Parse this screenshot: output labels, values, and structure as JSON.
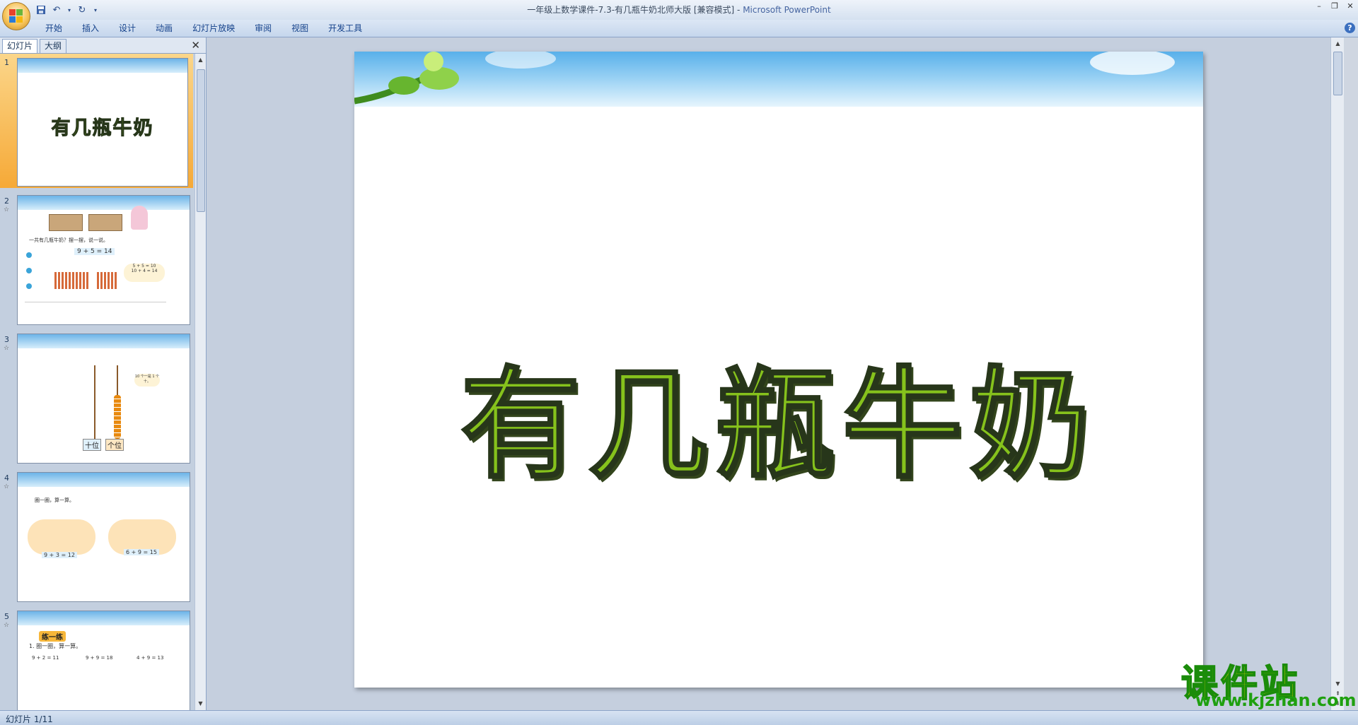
{
  "window": {
    "title": "一年级上数学课件-7.3-有几瓶牛奶北师大版 [兼容模式]",
    "separator": " - ",
    "app_name": "Microsoft PowerPoint"
  },
  "ribbon_tabs": [
    "开始",
    "插入",
    "设计",
    "动画",
    "幻灯片放映",
    "审阅",
    "视图",
    "开发工具"
  ],
  "pane": {
    "tab_slides": "幻灯片",
    "tab_outline": "大纲",
    "close": "✕"
  },
  "thumbnails": [
    {
      "num": "1",
      "title": "有几瓶牛奶"
    },
    {
      "num": "2",
      "prompt": "一共有几瓶牛奶？摆一摆，说一说。",
      "eq": "9 + 5 = 14",
      "bubble1": "5 + 5 = 10",
      "bubble2": "10 + 4 = 14"
    },
    {
      "num": "3",
      "label_tens": "十位",
      "label_ones": "个位",
      "bubble": "10 个一是 1 个十。"
    },
    {
      "num": "4",
      "prompt": "圈一圈，算一算。",
      "eq1": "9 + 3 = 12",
      "eq2": "6 + 9 = 15"
    },
    {
      "num": "5",
      "heading": "练一练",
      "prompt": "1. 圈一圈，算一算。",
      "eq1": "9 + 2 = 11",
      "eq2": "9 + 9 = 18",
      "eq3": "4 + 9 = 13"
    }
  ],
  "slide": {
    "title": "有几瓶牛奶"
  },
  "watermark": {
    "text": "课件站",
    "url": "www.kjzhan.com"
  },
  "status": {
    "slide_indicator": "幻灯片 1/11"
  },
  "colors": {
    "title_green": "#86c21c",
    "selected_thumb": "#f6a937",
    "ribbon_text": "#15428b"
  }
}
